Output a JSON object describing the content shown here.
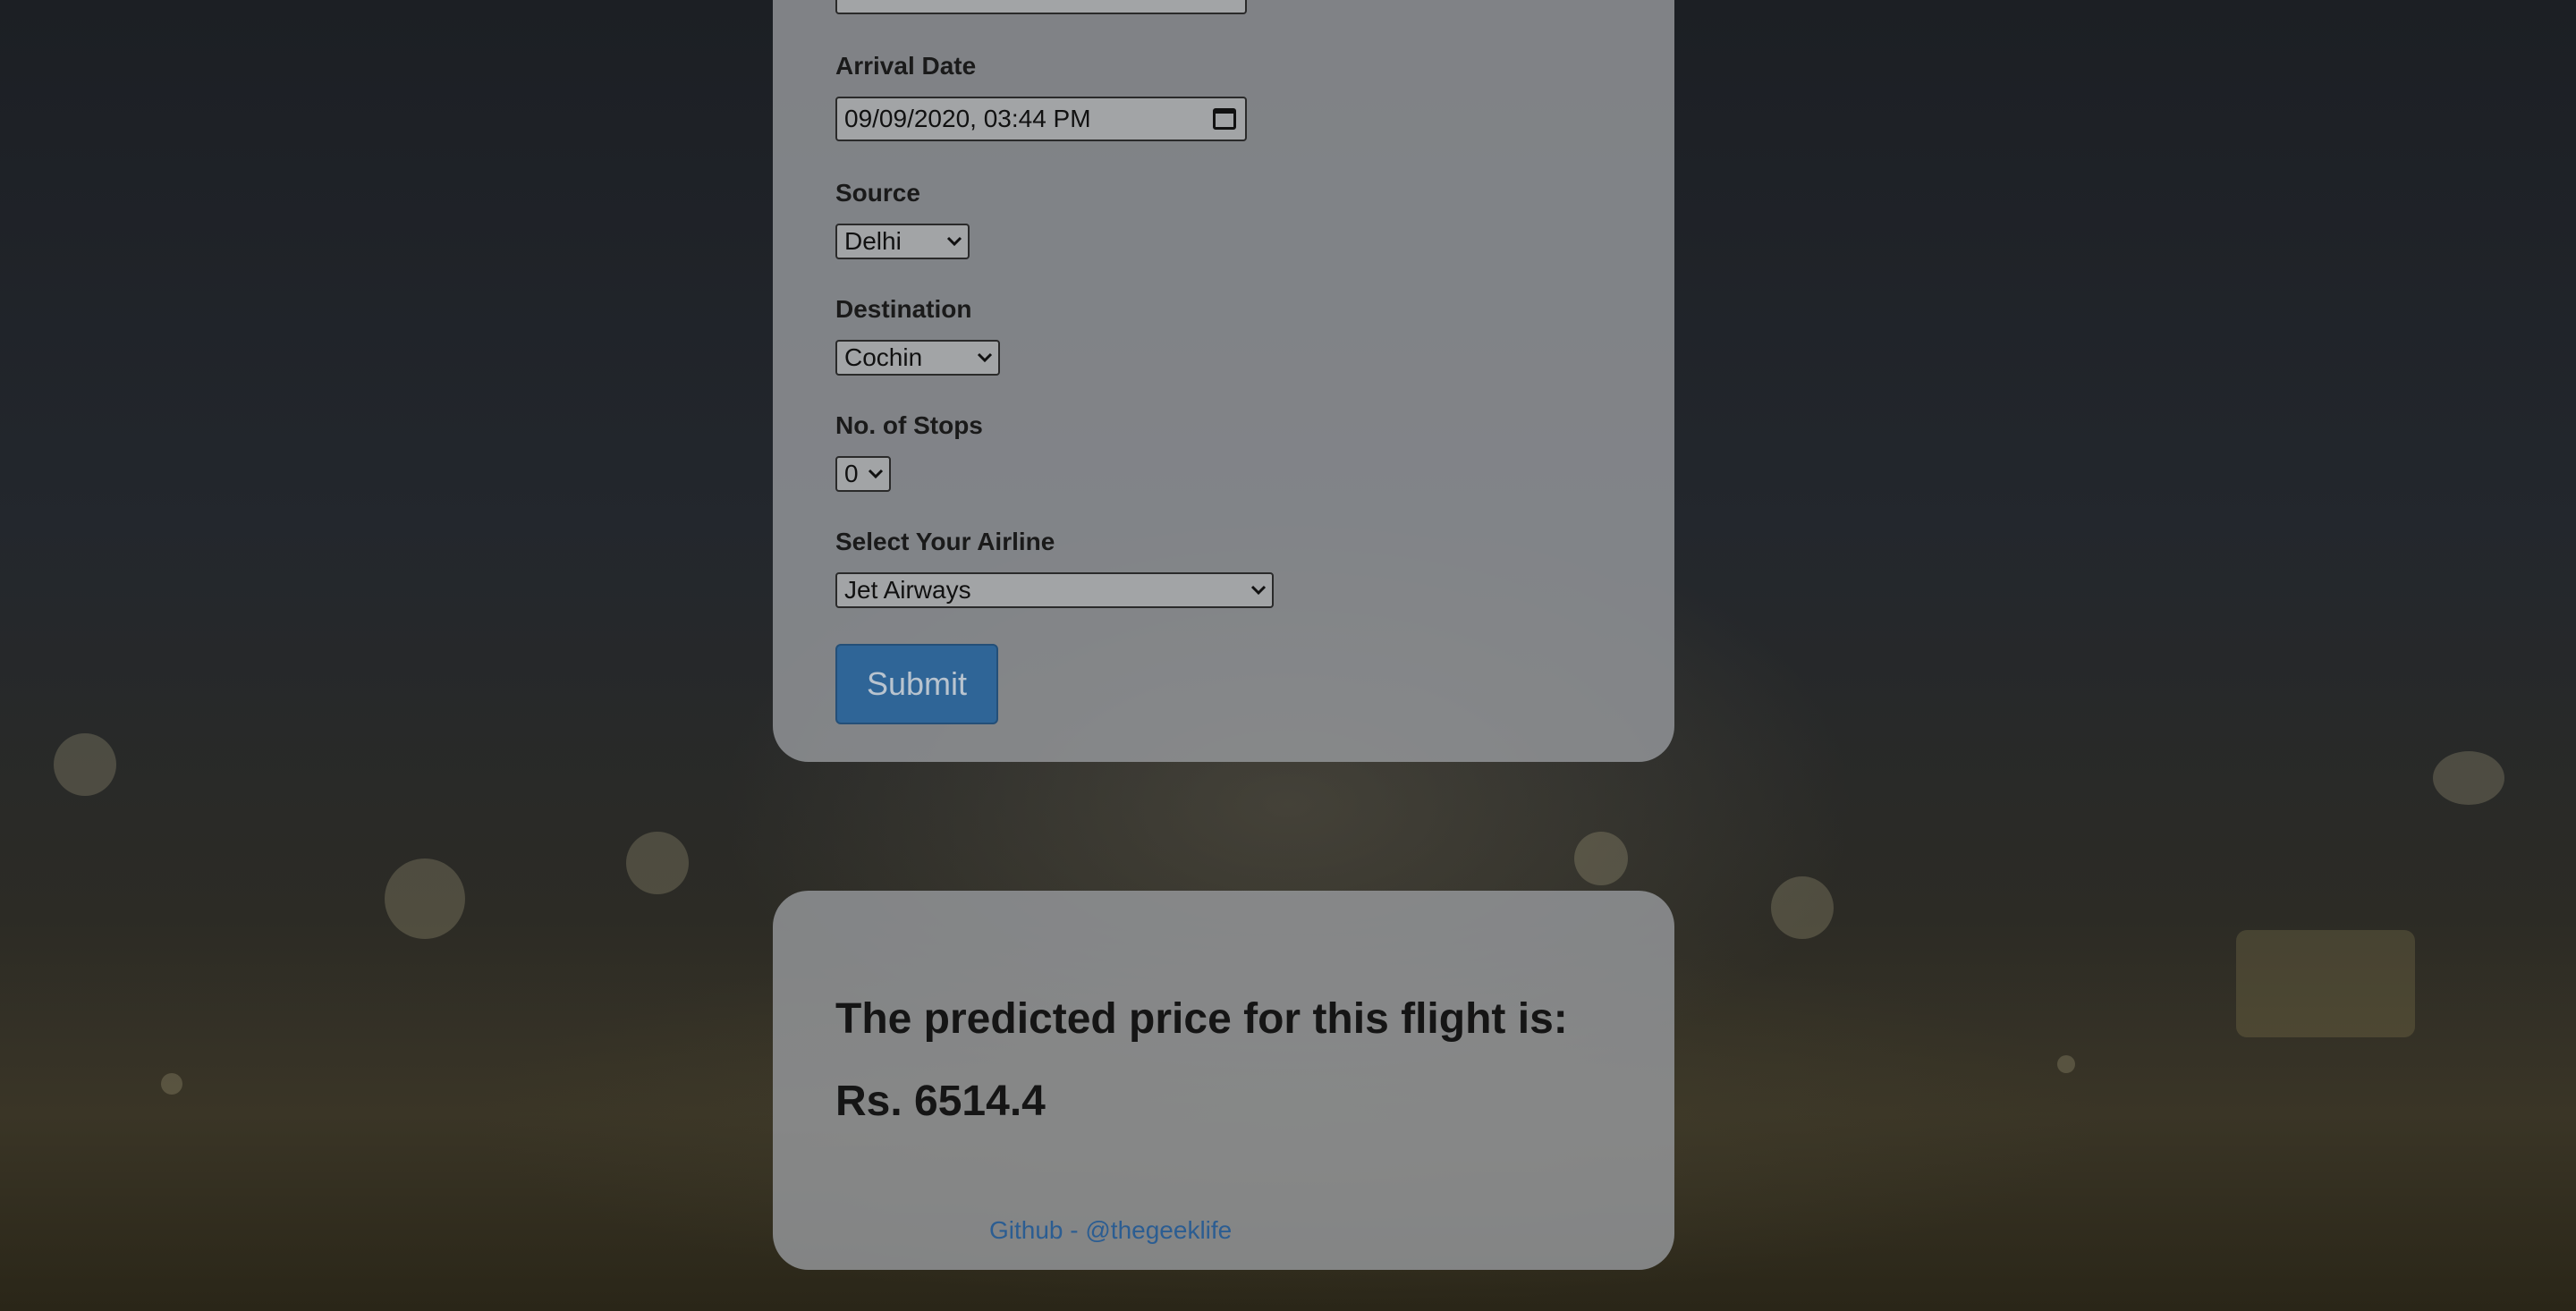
{
  "form": {
    "arrival_date": {
      "label": "Arrival Date",
      "value": "09/09/2020, 03:44 PM",
      "icon": "calendar-icon"
    },
    "source": {
      "label": "Source",
      "value": "Delhi"
    },
    "destination": {
      "label": "Destination",
      "value": "Cochin"
    },
    "stops": {
      "label": "No. of Stops",
      "value": "0"
    },
    "airline": {
      "label": "Select Your Airline",
      "value": "Jet Airways"
    },
    "submit_label": "Submit"
  },
  "result": {
    "heading": "The predicted price for this flight is:",
    "price": "Rs. 6514.4"
  },
  "footer": {
    "link_text": "Github - @thegeeklife"
  },
  "colors": {
    "submit_button": "#2f6597",
    "link": "#2b5d92"
  }
}
